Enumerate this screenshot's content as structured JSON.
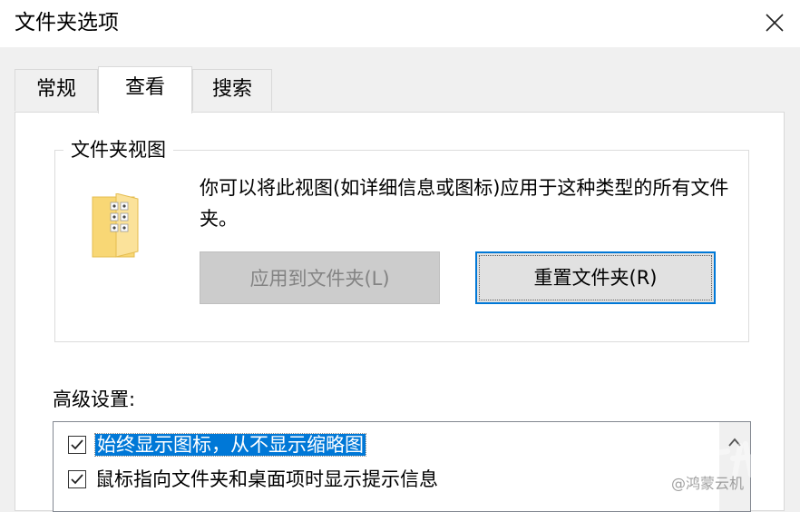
{
  "window": {
    "title": "文件夹选项"
  },
  "tabs": [
    {
      "label": "常规",
      "active": false
    },
    {
      "label": "查看",
      "active": true
    },
    {
      "label": "搜索",
      "active": false
    }
  ],
  "folder_views": {
    "group_label": "文件夹视图",
    "description": "你可以将此视图(如详细信息或图标)应用于这种类型的所有文件夹。",
    "apply_button": {
      "label": "应用到文件夹(L)",
      "enabled": false
    },
    "reset_button": {
      "label": "重置文件夹(R)",
      "enabled": true
    }
  },
  "advanced": {
    "label": "高级设置:",
    "items": [
      {
        "label": "始终显示图标，从不显示缩略图",
        "checked": true,
        "selected": true
      },
      {
        "label": "鼠标指向文件夹和桌面项时显示提示信息",
        "checked": true,
        "selected": false
      }
    ]
  },
  "watermark": {
    "text": "@鸿蒙云机"
  },
  "colors": {
    "accent": "#0078d7",
    "folder": "#f8d775"
  }
}
